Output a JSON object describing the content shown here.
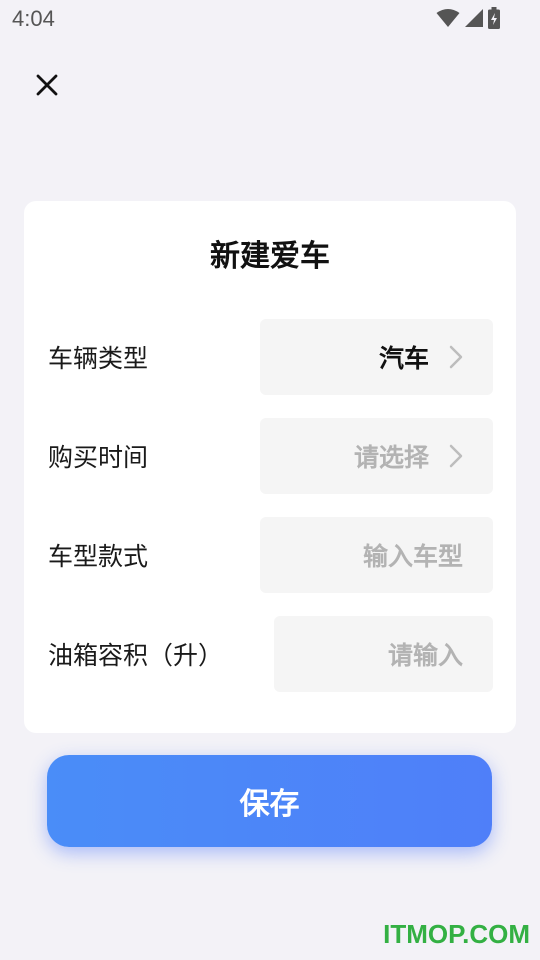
{
  "status_bar": {
    "time": "4:04",
    "icons": [
      "wifi-icon",
      "signal-icon",
      "battery-charging-icon"
    ]
  },
  "header": {
    "close_icon": "close-icon"
  },
  "form": {
    "title": "新建爱车",
    "rows": [
      {
        "label": "车辆类型",
        "value": "汽车",
        "placeholder": "",
        "has_chevron": true
      },
      {
        "label": "购买时间",
        "value": "",
        "placeholder": "请选择",
        "has_chevron": true
      },
      {
        "label": "车型款式",
        "value": "",
        "placeholder": "输入车型",
        "has_chevron": false
      },
      {
        "label": "油箱容积（升）",
        "value": "",
        "placeholder": "请输入",
        "has_chevron": false
      }
    ]
  },
  "actions": {
    "save_label": "保存"
  },
  "watermark": "ITMOP.COM",
  "colors": {
    "background": "#f3f2f7",
    "card": "#ffffff",
    "field_bg": "#f5f5f5",
    "placeholder": "#b3b3b3",
    "accent": "#4f84f9",
    "watermark": "#33b043"
  }
}
